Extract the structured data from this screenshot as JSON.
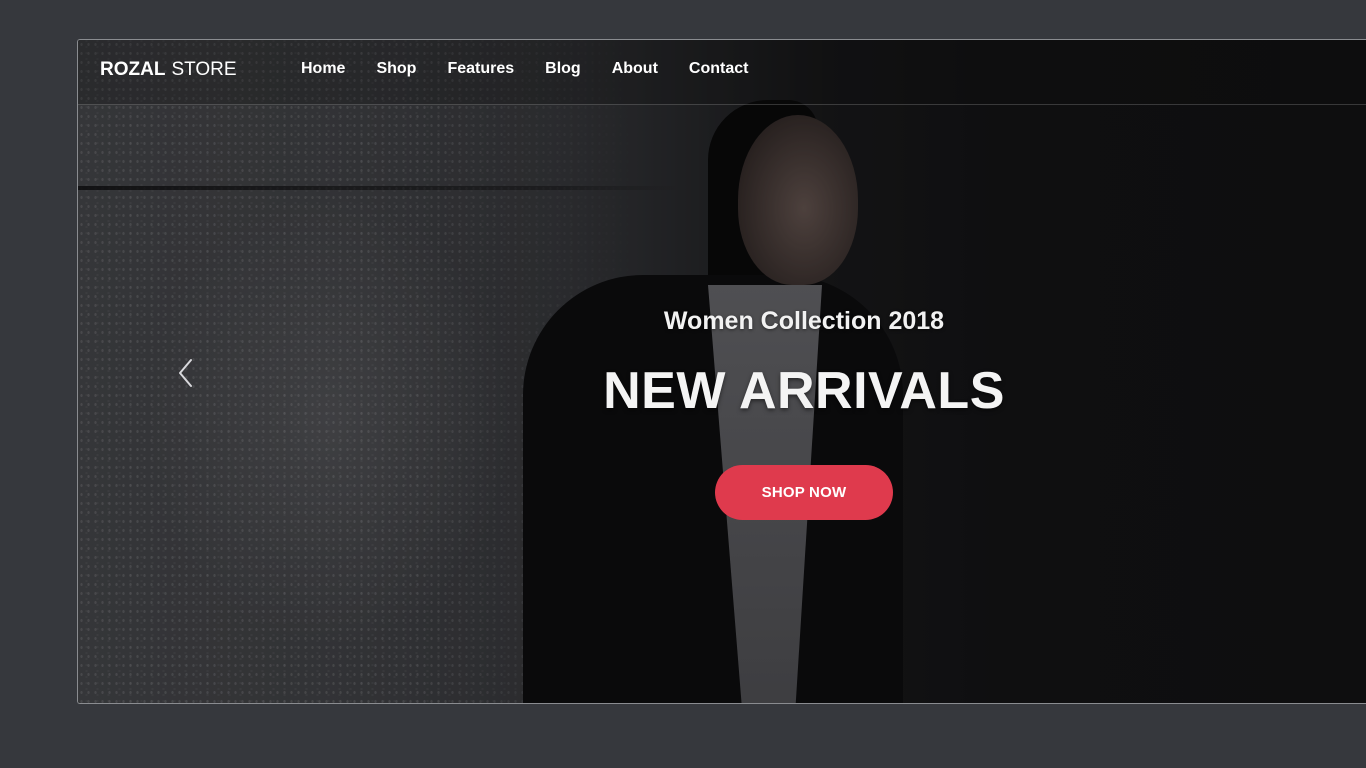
{
  "header": {
    "logo_strong": "ROZAL",
    "logo_light": "STORE",
    "nav": [
      "Home",
      "Shop",
      "Features",
      "Blog",
      "About",
      "Contact"
    ]
  },
  "hero": {
    "subtitle": "Women Collection 2018",
    "title": "NEW ARRIVALS",
    "cta_label": "SHOP NOW",
    "prev_icon": "chevron-left-icon"
  },
  "colors": {
    "page_background": "#36383d",
    "cta": "#df3a4d",
    "text": "#ffffff"
  }
}
